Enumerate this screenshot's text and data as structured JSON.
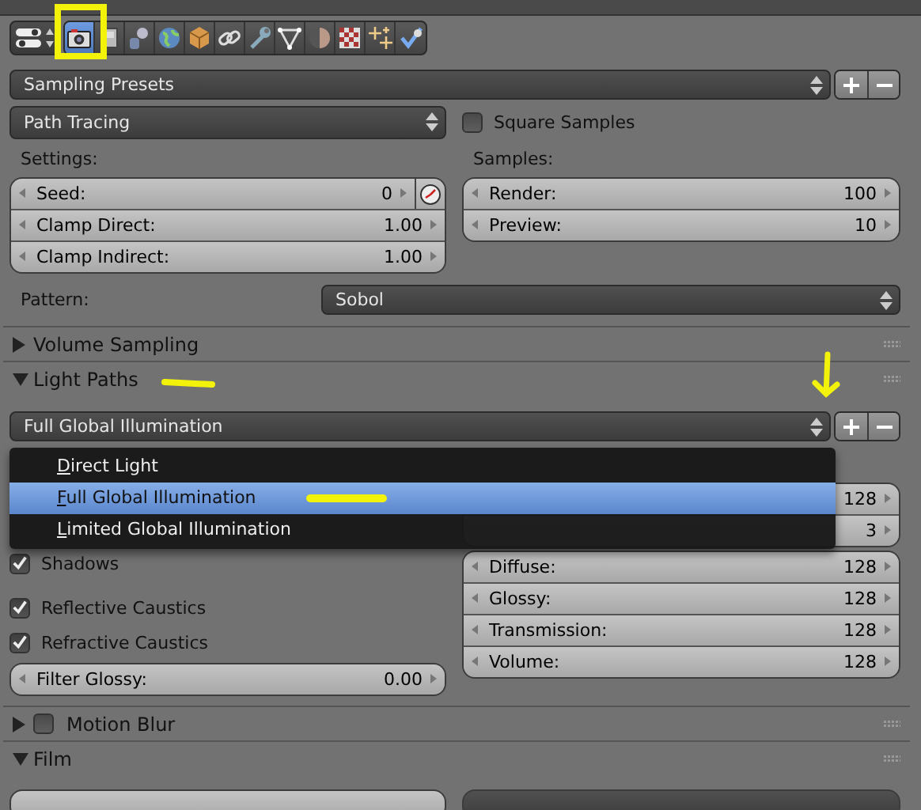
{
  "toolbar": {
    "tabs": [
      {
        "kind": "render",
        "selected": true
      },
      {
        "kind": "layers",
        "selected": false
      },
      {
        "kind": "scene",
        "selected": false
      },
      {
        "kind": "world",
        "selected": false
      },
      {
        "kind": "object",
        "selected": false
      },
      {
        "kind": "constraints",
        "selected": false
      },
      {
        "kind": "modifiers",
        "selected": false
      },
      {
        "kind": "data",
        "selected": false
      },
      {
        "kind": "material",
        "selected": false
      },
      {
        "kind": "texture",
        "selected": false
      },
      {
        "kind": "particles",
        "selected": false
      },
      {
        "kind": "physics",
        "selected": false
      }
    ]
  },
  "presets": {
    "label": "Sampling Presets"
  },
  "integrator": {
    "value": "Path Tracing",
    "square_samples": {
      "label": "Square Samples",
      "checked": false
    }
  },
  "settings": {
    "label": "Settings:",
    "fields": [
      {
        "label": "Seed:",
        "value": "0",
        "animate_button": true
      },
      {
        "label": "Clamp Direct:",
        "value": "1.00",
        "animate_button": false
      },
      {
        "label": "Clamp Indirect:",
        "value": "1.00",
        "animate_button": false
      }
    ]
  },
  "samples": {
    "label": "Samples:",
    "fields": [
      {
        "label": "Render:",
        "value": "100"
      },
      {
        "label": "Preview:",
        "value": "10"
      }
    ]
  },
  "pattern": {
    "label": "Pattern:",
    "value": "Sobol"
  },
  "panels": [
    {
      "title": "Volume Sampling",
      "expanded": false
    },
    {
      "title": "Light Paths",
      "expanded": true
    }
  ],
  "light_paths": {
    "preset": "Full Global Illumination",
    "menu": [
      {
        "label": "Direct Light",
        "selected": false
      },
      {
        "label": "Full Global Illumination",
        "selected": true
      },
      {
        "label": "Limited Global Illumination",
        "selected": false
      }
    ],
    "bounces": {
      "max_value": "128",
      "min_value": "3"
    },
    "options": [
      {
        "label": "Shadows",
        "checked": true
      },
      {
        "label": "Reflective Caustics",
        "checked": true
      },
      {
        "label": "Refractive Caustics",
        "checked": true
      }
    ],
    "filter_glossy": {
      "label": "Filter Glossy:",
      "value": "0.00"
    },
    "bounce_fields": [
      {
        "label": "Diffuse:",
        "value": "128"
      },
      {
        "label": "Glossy:",
        "value": "128"
      },
      {
        "label": "Transmission:",
        "value": "128"
      },
      {
        "label": "Volume:",
        "value": "128"
      }
    ]
  },
  "motion_blur": {
    "title": "Motion Blur",
    "expanded": false,
    "enabled": false
  },
  "film": {
    "title": "Film",
    "expanded": true
  }
}
